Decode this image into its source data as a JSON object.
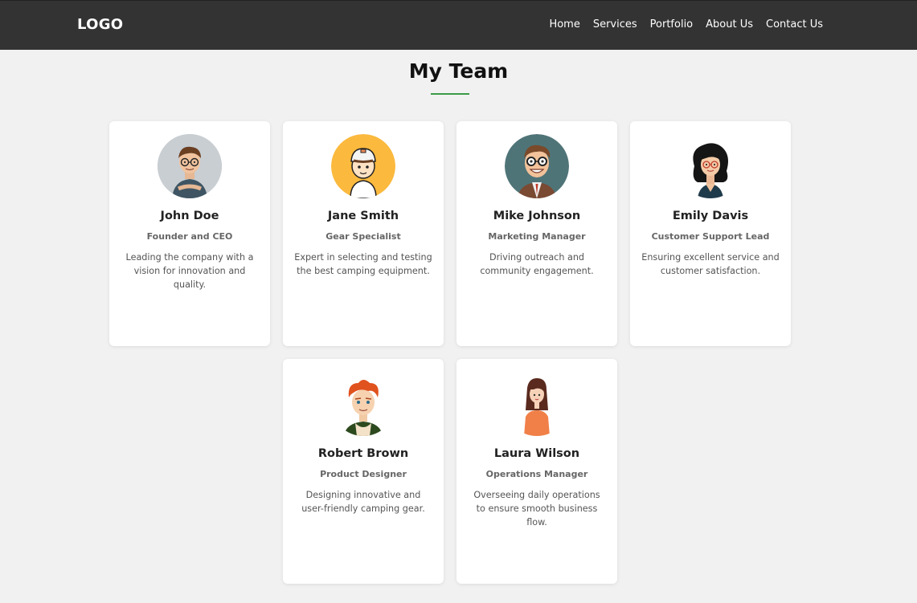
{
  "header": {
    "logo": "LOGO",
    "nav": [
      "Home",
      "Services",
      "Portfolio",
      "About Us",
      "Contact Us"
    ]
  },
  "page": {
    "title": "My Team"
  },
  "colors": {
    "header_bg": "#333333",
    "accent": "#3a9a45",
    "page_bg": "#f1f1f1"
  },
  "team": [
    {
      "name": "John Doe",
      "role": "Founder and CEO",
      "bio": "Leading the company with a vision for innovation and quality.",
      "avatar": "man-glasses-avatar"
    },
    {
      "name": "Jane Smith",
      "role": "Gear Specialist",
      "bio": "Expert in selecting and testing the best camping equipment.",
      "avatar": "boy-cap-avatar"
    },
    {
      "name": "Mike Johnson",
      "role": "Marketing Manager",
      "bio": "Driving outreach and community engagement.",
      "avatar": "smiling-man-glasses-avatar"
    },
    {
      "name": "Emily Davis",
      "role": "Customer Support Lead",
      "bio": "Ensuring excellent service and customer satisfaction.",
      "avatar": "woman-glasses-avatar"
    },
    {
      "name": "Robert Brown",
      "role": "Product Designer",
      "bio": "Designing innovative and user-friendly camping gear.",
      "avatar": "red-hair-man-avatar"
    },
    {
      "name": "Laura Wilson",
      "role": "Operations Manager",
      "bio": "Overseeing daily operations to ensure smooth business flow.",
      "avatar": "woman-orange-top-avatar"
    }
  ]
}
